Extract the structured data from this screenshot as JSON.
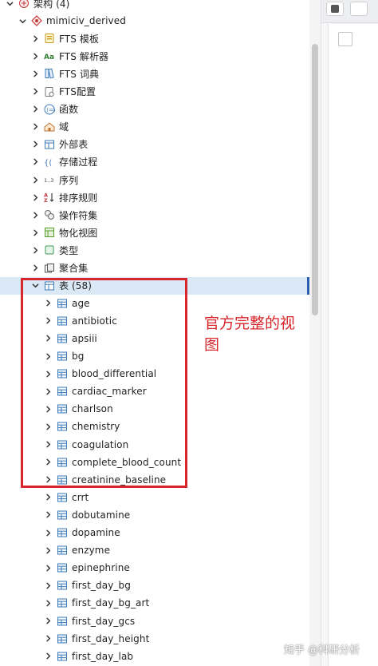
{
  "tree": {
    "top_node": {
      "label": "架构 (4)"
    },
    "schema": {
      "label": "mimiciv_derived"
    },
    "categories": [
      {
        "label": "FTS 模板",
        "icon": "fts-template-icon"
      },
      {
        "label": "FTS 解析器",
        "icon": "fts-parser-icon"
      },
      {
        "label": "FTS 词典",
        "icon": "fts-dictionary-icon"
      },
      {
        "label": "FTS配置",
        "icon": "fts-config-icon"
      },
      {
        "label": "函数",
        "icon": "function-icon"
      },
      {
        "label": "域",
        "icon": "domain-icon"
      },
      {
        "label": "外部表",
        "icon": "foreign-table-icon"
      },
      {
        "label": "存储过程",
        "icon": "procedure-icon"
      },
      {
        "label": "序列",
        "icon": "sequence-icon"
      },
      {
        "label": "排序规则",
        "icon": "collation-icon"
      },
      {
        "label": "操作符集",
        "icon": "operator-icon"
      },
      {
        "label": "物化视图",
        "icon": "materialized-view-icon"
      },
      {
        "label": "类型",
        "icon": "type-icon"
      },
      {
        "label": "聚合集",
        "icon": "aggregate-icon"
      }
    ],
    "tables_node": {
      "label": "表 (58)"
    },
    "tables": [
      "age",
      "antibiotic",
      "apsiii",
      "bg",
      "blood_differential",
      "cardiac_marker",
      "charlson",
      "chemistry",
      "coagulation",
      "complete_blood_count",
      "creatinine_baseline",
      "crrt",
      "dobutamine",
      "dopamine",
      "enzyme",
      "epinephrine",
      "first_day_bg",
      "first_day_bg_art",
      "first_day_gcs",
      "first_day_height",
      "first_day_lab"
    ]
  },
  "annotation": {
    "text": "官方完整的视图",
    "color": "#d8262a"
  },
  "watermark": {
    "text": "知乎 @科研分析"
  },
  "colors": {
    "selection": "#dbe9f6",
    "table_icon": "#3d7ab8",
    "accent": "#2a5db0"
  }
}
